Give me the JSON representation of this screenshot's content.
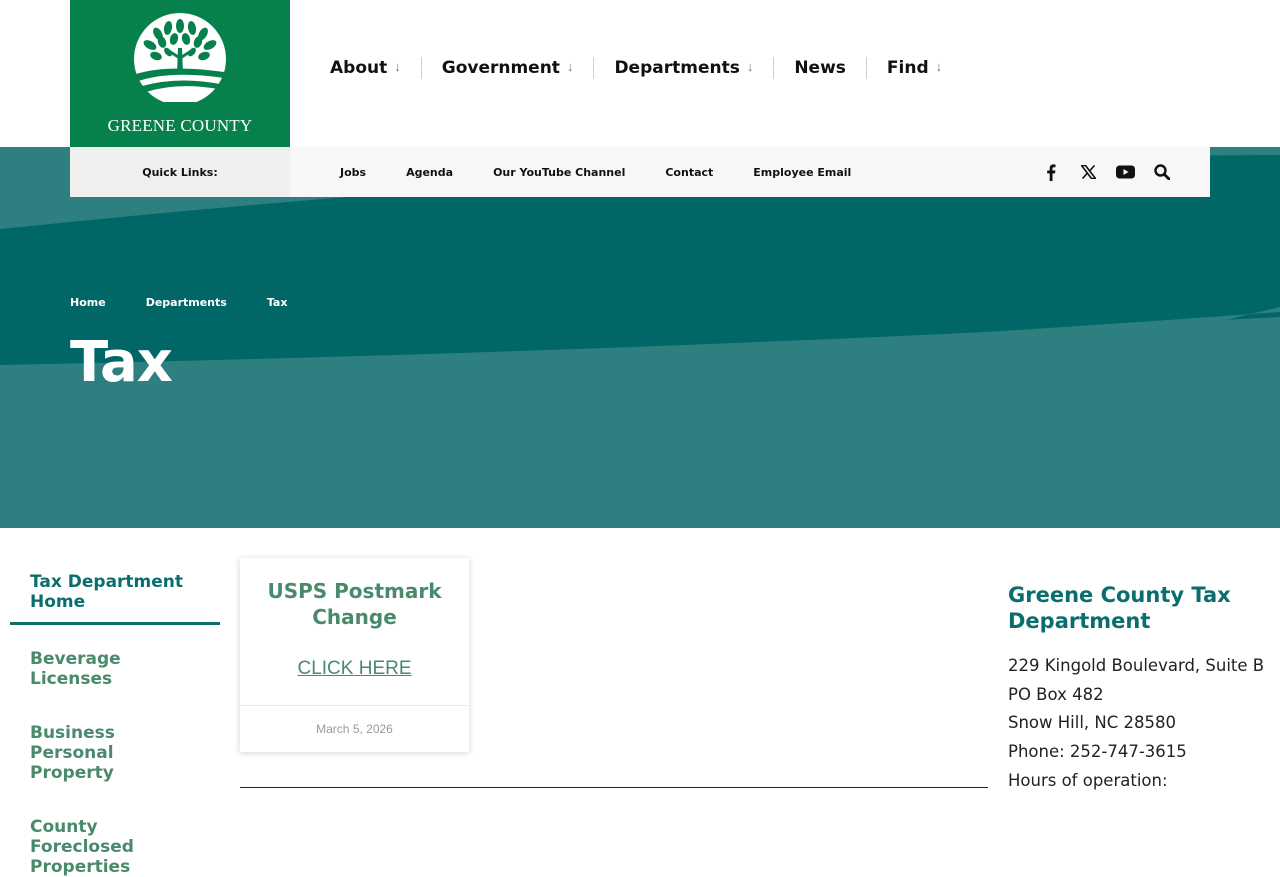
{
  "logo": {
    "text": "GREENE COUNTY",
    "brand_color": "#06814c"
  },
  "main_nav": [
    {
      "label": "About",
      "has_dropdown": true
    },
    {
      "label": "Government",
      "has_dropdown": true
    },
    {
      "label": "Departments",
      "has_dropdown": true
    },
    {
      "label": "News",
      "has_dropdown": false
    },
    {
      "label": "Find",
      "has_dropdown": true
    }
  ],
  "dropdown_arrow": "↓",
  "quick_links": {
    "label": "Quick Links:",
    "links": [
      "Jobs",
      "Agenda",
      "Our YouTube Channel",
      "Contact",
      "Employee Email"
    ],
    "icons": [
      "facebook-icon",
      "x-twitter-icon",
      "youtube-icon",
      "search-icon"
    ]
  },
  "hero": {
    "colors": {
      "dark": "#006666",
      "light": "#2e8080"
    },
    "breadcrumb": [
      "Home",
      "Departments",
      "Tax"
    ],
    "title": "Tax"
  },
  "sidebar": {
    "items": [
      {
        "label": "Tax Department Home",
        "active": true
      },
      {
        "label": "Beverage Licenses",
        "active": false
      },
      {
        "label": "Business Personal Property",
        "active": false
      },
      {
        "label": "County Foreclosed Properties",
        "active": false
      }
    ]
  },
  "card": {
    "title": "USPS Postmark Change",
    "link": "CLICK HERE",
    "date": "March 5, 2026"
  },
  "contact": {
    "title": "Greene County Tax Department",
    "lines": [
      "229 Kingold Boulevard, Suite B",
      "PO Box 482",
      "Snow Hill, NC 28580",
      "Phone: 252-747-3615",
      "Hours of operation:"
    ]
  }
}
